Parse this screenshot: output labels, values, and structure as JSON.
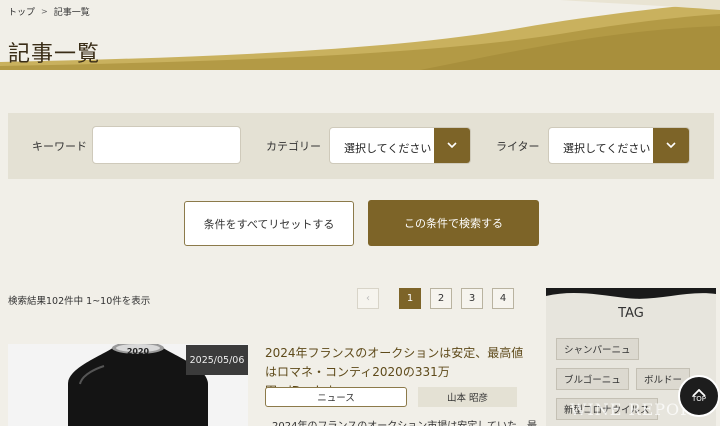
{
  "breadcrumb": {
    "home": "トップ",
    "separator": ">",
    "current": "記事一覧"
  },
  "page_title": "記事一覧",
  "search": {
    "keyword_label": "キーワード",
    "keyword_value": "",
    "category_label": "カテゴリー",
    "category_value": "選択してください",
    "writer_label": "ライター",
    "writer_value": "選択してください",
    "reset_label": "条件をすべてリセットする",
    "submit_label": "この条件で検索する"
  },
  "results": {
    "summary": "検索結果102件中 1~10件を表示",
    "pages": [
      "1",
      "2",
      "3",
      "4"
    ],
    "current_page": "1"
  },
  "article": {
    "date": "2025/05/06",
    "bottle_label": "2020",
    "title": "2024年フランスのオークションは安定、最高値はロマネ・コンティ2020の331万円...iDealwine",
    "category": "ニュース",
    "writer": "山本 昭彦",
    "excerpt": "2024年のフランスのオークション市場は安定していた。最"
  },
  "sidebar": {
    "title": "TAG",
    "tags": [
      "シャンパーニュ",
      "ブルゴーニュ",
      "ボルドー",
      "新型コロナウイルス"
    ],
    "watermark": "WINE REPORT"
  },
  "top_button": {
    "label": "TOP"
  },
  "colors": {
    "accent": "#7d6428",
    "background": "#f1efe8",
    "panel": "#e4e1d4"
  }
}
